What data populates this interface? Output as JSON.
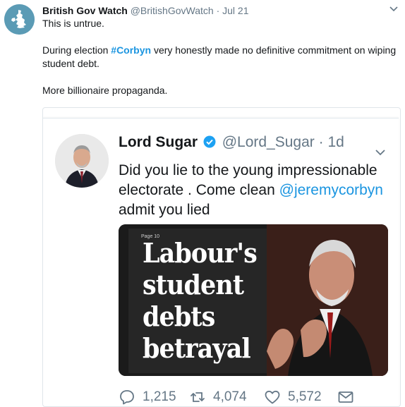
{
  "tweet": {
    "author_name": "British Gov Watch",
    "author_handle": "@BritishGovWatch",
    "separator": "·",
    "time": "Jul 21",
    "line1": "This is untrue.",
    "line2_prefix": "During election ",
    "hashtag": "#Corbyn",
    "line2_suffix": " very honestly made no definitive commitment on wiping student debt.",
    "line3": "More billionaire propaganda."
  },
  "quoted_tweet": {
    "author_name": "Lord Sugar",
    "author_handle": "@Lord_Sugar",
    "separator": "·",
    "time": "1d",
    "text_prefix": "Did you lie to the young impressionable electorate . Come clean ",
    "mention": "@jeremycorbyn",
    "text_suffix": " admit you lied",
    "media": {
      "headline": "Labour's\nstudent\ndebts\nbetrayal",
      "page_tag": "Page 10"
    },
    "actions": {
      "replies": "1,215",
      "retweets": "4,074",
      "likes": "5,572"
    }
  },
  "icons": {
    "avatar": "uk-map-icon",
    "reply": "reply-icon",
    "retweet": "retweet-icon",
    "like": "heart-icon",
    "message": "envelope-icon",
    "menu": "chevron-down-icon",
    "verified": "verified-badge-icon"
  },
  "colors": {
    "link": "#1b95e0",
    "verified": "#1da1f2",
    "secondary_text": "#657786",
    "avatar_bg": "#5b9bb5"
  }
}
